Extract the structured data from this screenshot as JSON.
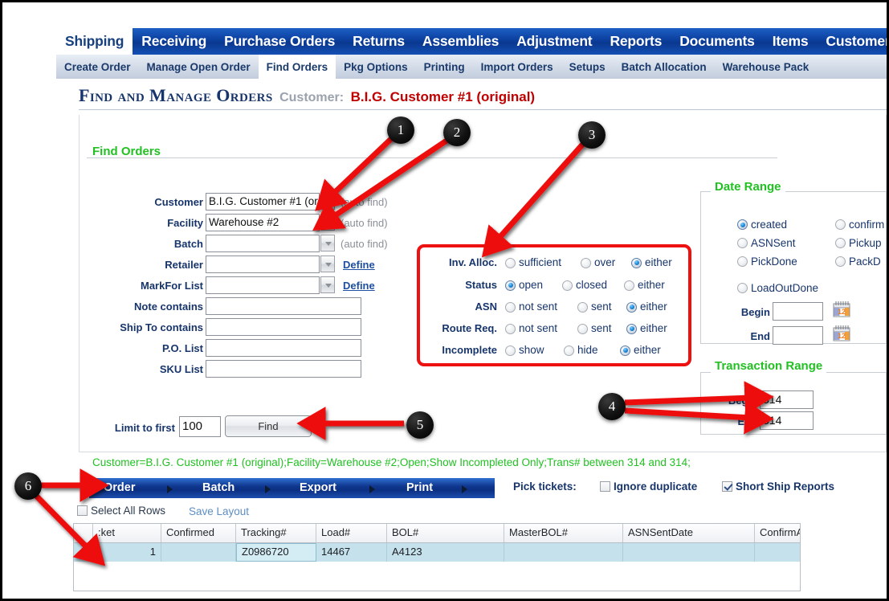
{
  "mainnav": {
    "tabs": [
      {
        "label": "Shipping",
        "active": true
      },
      {
        "label": "Receiving",
        "active": false
      },
      {
        "label": "Purchase Orders",
        "active": false
      },
      {
        "label": "Returns",
        "active": false
      },
      {
        "label": "Assemblies",
        "active": false
      },
      {
        "label": "Adjustment",
        "active": false
      },
      {
        "label": "Reports",
        "active": false
      },
      {
        "label": "Documents",
        "active": false
      },
      {
        "label": "Items",
        "active": false
      },
      {
        "label": "Customer",
        "active": false
      }
    ]
  },
  "subnav": {
    "tabs": [
      {
        "label": "Create Order",
        "active": false
      },
      {
        "label": "Manage Open Order",
        "active": false
      },
      {
        "label": "Find Orders",
        "active": true
      },
      {
        "label": "Pkg Options",
        "active": false
      },
      {
        "label": "Printing",
        "active": false
      },
      {
        "label": "Import Orders",
        "active": false
      },
      {
        "label": "Setups",
        "active": false
      },
      {
        "label": "Batch Allocation",
        "active": false
      },
      {
        "label": "Warehouse Pack",
        "active": false
      }
    ]
  },
  "title": {
    "heading": "Find and Manage Orders",
    "customer_label": "Customer:",
    "customer_value": "B.I.G. Customer #1 (original)"
  },
  "find_orders": {
    "legend": "Find Orders",
    "fields": [
      {
        "label": "Customer",
        "value": "B.I.G. Customer #1 (or",
        "hint": "(auto find)",
        "hint_type": "auto",
        "has_arrow": true
      },
      {
        "label": "Facility",
        "value": "Warehouse #2",
        "hint": "(auto find)",
        "hint_type": "auto",
        "has_arrow": true
      },
      {
        "label": "Batch",
        "value": "",
        "hint": "(auto find)",
        "hint_type": "auto",
        "has_arrow": true
      },
      {
        "label": "Retailer",
        "value": "",
        "hint": "Define",
        "hint_type": "link",
        "has_arrow": true
      },
      {
        "label": "MarkFor List",
        "value": "",
        "hint": "Define",
        "hint_type": "link",
        "has_arrow": true
      },
      {
        "label": "Note contains",
        "value": "",
        "hint": "",
        "hint_type": "none",
        "has_arrow": false
      },
      {
        "label": "Ship To contains",
        "value": "",
        "hint": "",
        "hint_type": "none",
        "has_arrow": false
      },
      {
        "label": "P.O. List",
        "value": "",
        "hint": "",
        "hint_type": "none",
        "has_arrow": false
      },
      {
        "label": "SKU List",
        "value": "",
        "hint": "",
        "hint_type": "none",
        "has_arrow": false
      }
    ],
    "limit_label": "Limit to first",
    "limit_value": "100",
    "find_button": "Find"
  },
  "filters": {
    "rows": [
      {
        "label": "Inv. Alloc.",
        "options": [
          {
            "label": "sufficient",
            "selected": false
          },
          {
            "label": "over",
            "selected": false
          },
          {
            "label": "either",
            "selected": true
          }
        ]
      },
      {
        "label": "Status",
        "options": [
          {
            "label": "open",
            "selected": true
          },
          {
            "label": "closed",
            "selected": false
          },
          {
            "label": "either",
            "selected": false
          }
        ]
      },
      {
        "label": "ASN",
        "options": [
          {
            "label": "not sent",
            "selected": false
          },
          {
            "label": "sent",
            "selected": false
          },
          {
            "label": "either",
            "selected": true
          }
        ]
      },
      {
        "label": "Route Req.",
        "options": [
          {
            "label": "not sent",
            "selected": false
          },
          {
            "label": "sent",
            "selected": false
          },
          {
            "label": "either",
            "selected": true
          }
        ]
      },
      {
        "label": "Incomplete",
        "options": [
          {
            "label": "show",
            "selected": false
          },
          {
            "label": "hide",
            "selected": false
          },
          {
            "label": "either",
            "selected": true
          }
        ]
      }
    ]
  },
  "date_range": {
    "legend": "Date Range",
    "options_left": [
      {
        "label": "created",
        "selected": true
      },
      {
        "label": "ASNSent",
        "selected": false
      },
      {
        "label": "PickDone",
        "selected": false
      },
      {
        "label": "LoadOutDone",
        "selected": false
      }
    ],
    "options_right": [
      {
        "label": "confirm",
        "selected": false
      },
      {
        "label": "Pickup",
        "selected": false
      },
      {
        "label": "PackD",
        "selected": false
      }
    ],
    "begin_label": "Begin",
    "begin_value": "",
    "end_label": "End",
    "end_value": "",
    "calendar_icon": "calendar-icon",
    "calendar_day": "12"
  },
  "transaction_range": {
    "legend": "Transaction Range",
    "begin_label": "Begin",
    "begin_value": "314",
    "end_label": "End",
    "end_value": "314"
  },
  "criteria_summary": "Customer=B.I.G. Customer #1 (original);Facility=Warehouse #2;Open;Show Incompleted Only;Trans# between 314 and 314;",
  "actionbar": {
    "items": [
      {
        "label": "Order"
      },
      {
        "label": "Batch"
      },
      {
        "label": "Export"
      },
      {
        "label": "Print"
      }
    ]
  },
  "pick_tickets": {
    "label": "Pick tickets:",
    "ignore_duplicate": {
      "label": "Ignore duplicate",
      "checked": false
    },
    "short_ship_reports": {
      "label": "Short Ship Reports",
      "checked": true
    }
  },
  "grid_controls": {
    "select_all_label": "Select All Rows",
    "select_all_checked": false,
    "save_layout": "Save Layout"
  },
  "grid": {
    "columns": [
      "",
      ":ket",
      "Confirmed",
      "Tracking#",
      "Load#",
      "BOL#",
      "MasterBOL#",
      "ASNSentDate",
      "ConfirmASNS"
    ],
    "rows": [
      {
        "cells": [
          "",
          "1",
          "",
          "Z0986720",
          "14467",
          "A4123",
          "",
          "",
          ""
        ]
      }
    ]
  },
  "callouts": [
    {
      "number": "1"
    },
    {
      "number": "2"
    },
    {
      "number": "3"
    },
    {
      "number": "4"
    },
    {
      "number": "5"
    },
    {
      "number": "6"
    }
  ],
  "colors": {
    "nav_blue": "#0b3f9e",
    "legend_green": "#22c023",
    "title_red": "#c00000",
    "callout_red": "#ee1111",
    "row_highlight": "#c5e2ec"
  }
}
